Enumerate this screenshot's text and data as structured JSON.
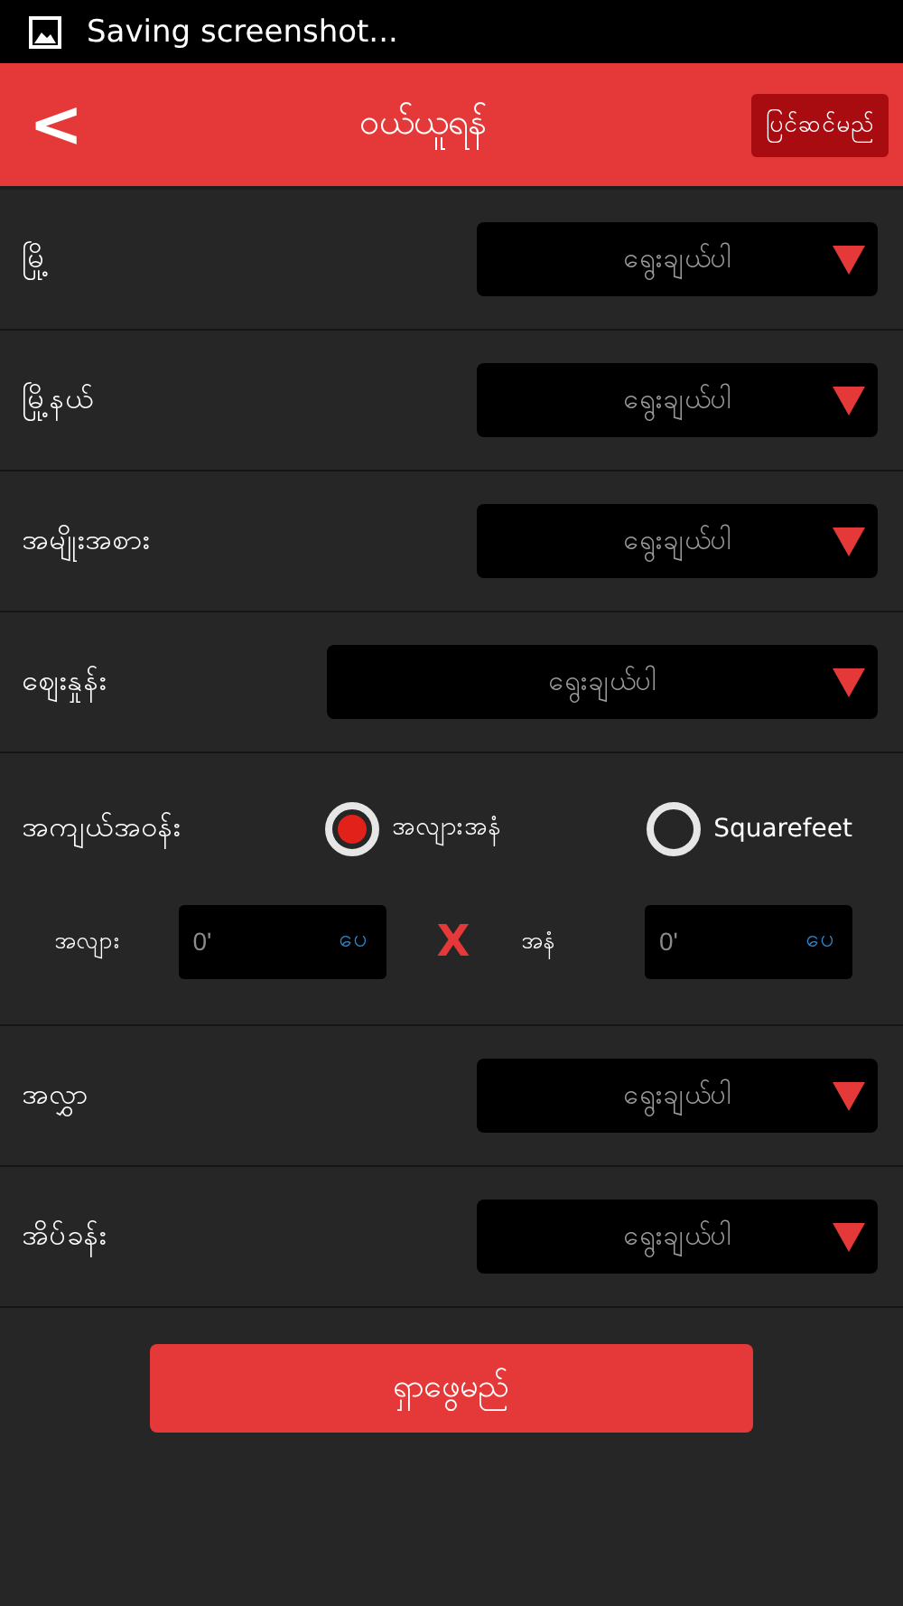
{
  "status_bar": {
    "text": "Saving screenshot..."
  },
  "header": {
    "back": "<",
    "title": "ဝယ်ယူရန်",
    "action": "ပြင်ဆင်မည်"
  },
  "fields": [
    {
      "kind": "select",
      "label": "မြို့",
      "value": "ရွေးချယ်ပါ"
    },
    {
      "kind": "select",
      "label": "မြို့နယ်",
      "value": "ရွေးချယ်ပါ"
    },
    {
      "kind": "select",
      "label": "အမျိုးအစား",
      "value": "ရွေးချယ်ပါ"
    },
    {
      "kind": "wide_select",
      "label": "ဈေးနှုန်း",
      "value": "ရွေးချယ်ပါ"
    },
    {
      "kind": "area",
      "label": "အကျယ်အဝန်း",
      "options": [
        {
          "label": "အလျားအနံ",
          "selected": true
        },
        {
          "label": "Squarefeet",
          "selected": false
        }
      ],
      "inputs": [
        {
          "label": "အလျား",
          "placeholder": "0'",
          "unit": "ပေ"
        },
        {
          "label": "အနံ",
          "placeholder": "0'",
          "unit": "ပေ"
        }
      ],
      "separator": "X"
    },
    {
      "kind": "select",
      "label": "အလွှာ",
      "value": "ရွေးချယ်ပါ"
    },
    {
      "kind": "select",
      "label": "အိပ်ခန်း",
      "value": "ရွေးချယ်ပါ"
    }
  ],
  "search_button": "ရှာဖွေမည်"
}
